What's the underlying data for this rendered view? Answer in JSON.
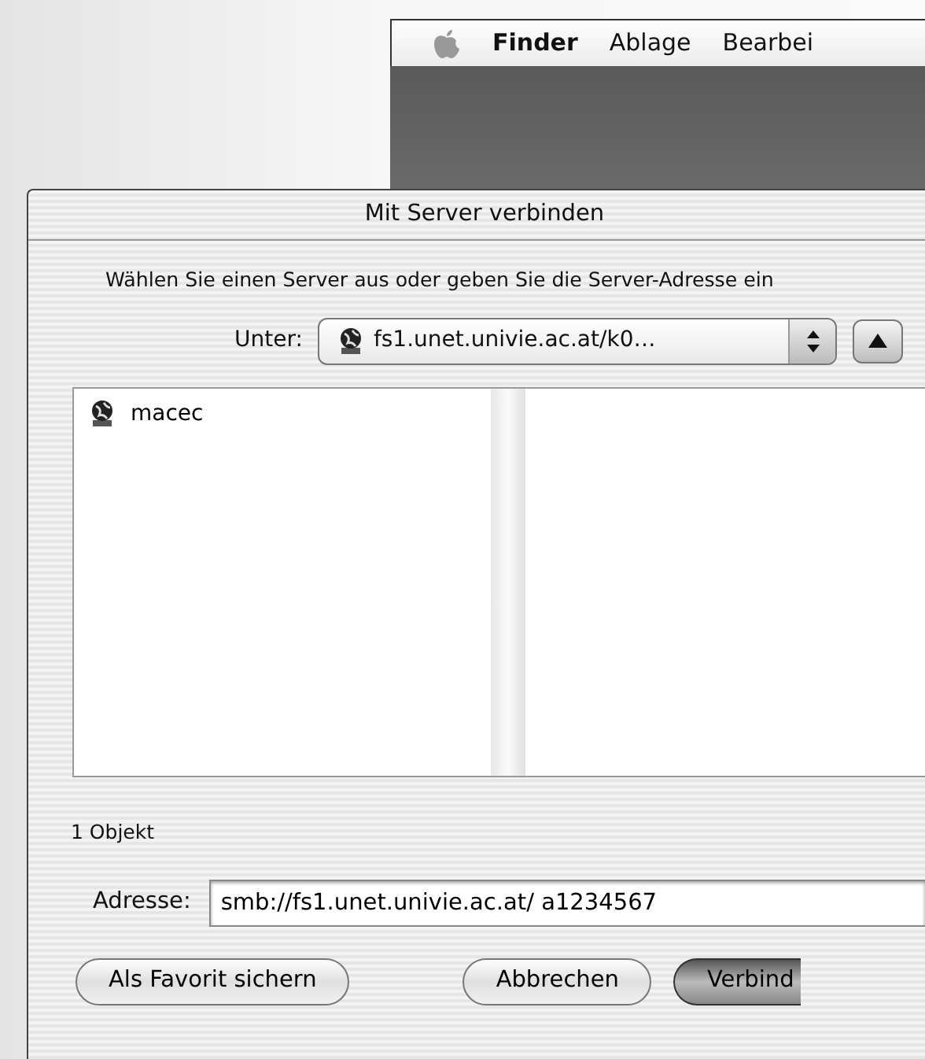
{
  "menu_bar": {
    "app_name": "Finder",
    "menus": [
      "Ablage",
      "Bearbei"
    ]
  },
  "dialog": {
    "title": "Mit Server verbinden",
    "instruction": "Wählen Sie einen Server aus oder geben Sie die Server-Adresse ein",
    "location": {
      "label": "Unter:",
      "value": "fs1.unet.univie.ac.at/k0…"
    },
    "browser": {
      "items": [
        {
          "name": "macec",
          "selected": false
        }
      ]
    },
    "status": "1 Objekt",
    "address": {
      "label": "Adresse:",
      "value": "smb://fs1.unet.univie.ac.at/ a1234567"
    },
    "buttons": [
      {
        "label": "Als Favorit sichern",
        "kind": "normal"
      },
      {
        "label": "Abbrechen",
        "kind": "normal"
      },
      {
        "label": "Verbind",
        "kind": "default"
      }
    ]
  }
}
